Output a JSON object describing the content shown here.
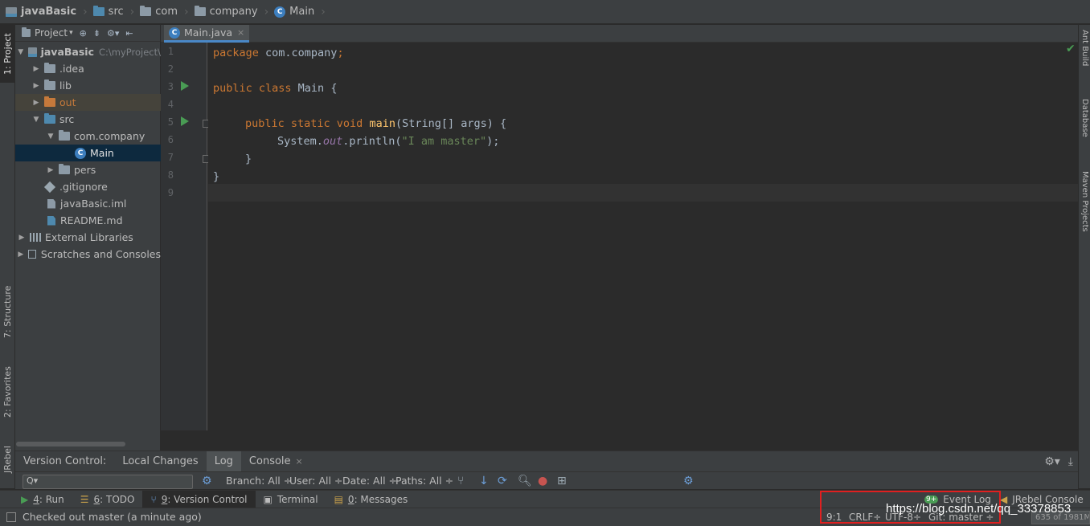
{
  "breadcrumb": [
    "javaBasic",
    "src",
    "com",
    "company",
    "Main"
  ],
  "left_tabs": {
    "project": "1: Project",
    "structure": "7: Structure",
    "favorites": "2: Favorites",
    "jrebel": "JRebel"
  },
  "right_tabs": {
    "ant": "Ant Build",
    "database": "Database",
    "maven": "Maven Projects"
  },
  "project_panel": {
    "title": "Project",
    "tree": [
      {
        "label": "javaBasic",
        "hint": "C:\\myProject\\"
      },
      {
        "label": ".idea"
      },
      {
        "label": "lib"
      },
      {
        "label": "out"
      },
      {
        "label": "src"
      },
      {
        "label": "com.company"
      },
      {
        "label": "Main"
      },
      {
        "label": "pers"
      },
      {
        "label": ".gitignore"
      },
      {
        "label": "javaBasic.iml"
      },
      {
        "label": "README.md"
      },
      {
        "label": "External Libraries"
      },
      {
        "label": "Scratches and Consoles"
      }
    ]
  },
  "editor": {
    "tab": "Main.java",
    "line_numbers": [
      "1",
      "2",
      "3",
      "4",
      "5",
      "6",
      "7",
      "8",
      "9"
    ],
    "code": {
      "l1_kw": "package",
      "l1_rest": " com.company",
      "l1_semi": ";",
      "l3_kw": "public class",
      "l3_rest": " Main {",
      "l5_kw": "public static void",
      "l5_fn": "main",
      "l5_rest": "(String[] args) {",
      "l6_a": "System.",
      "l6_out": "out",
      "l6_b": ".println(",
      "l6_str": "\"I am master\"",
      "l6_c": ");",
      "l7": "}",
      "l8": "}"
    }
  },
  "version_control": {
    "label": "Version Control:",
    "tabs": [
      "Local Changes",
      "Log",
      "Console"
    ],
    "search_placeholder": "Q▾",
    "filters": [
      "Branch: All ÷",
      "User: All ÷",
      "Date: All ÷",
      "Paths: All ÷"
    ]
  },
  "tool_windows": [
    {
      "num": "4",
      "label": ": Run"
    },
    {
      "num": "6",
      "label": ": TODO"
    },
    {
      "num": "9",
      "label": ": Version Control"
    },
    {
      "num": "",
      "label": "Terminal"
    },
    {
      "num": "0",
      "label": ": Messages"
    }
  ],
  "right_tools": {
    "event_log": "Event Log",
    "event_badge": "9+",
    "jrebel_console": "JRebel Console"
  },
  "status": {
    "message": "Checked out master (a minute ago)",
    "position": "9:1",
    "line_sep": "CRLF÷",
    "encoding": "UTF-8÷",
    "git": "Git: master ÷",
    "memory": "635 of 1981M"
  },
  "watermark": "https://blog.csdn.net/qq_33378853",
  "colors": {
    "keyword": "#cc7832",
    "function": "#ffc66d",
    "string": "#6a8759",
    "static_field": "#9876aa",
    "highlight": "#e02020"
  }
}
